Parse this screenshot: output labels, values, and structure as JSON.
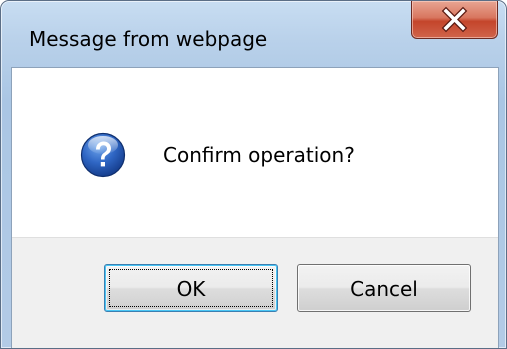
{
  "dialog": {
    "title": "Message from webpage",
    "message": "Confirm operation?",
    "icon": "question-icon",
    "buttons": {
      "ok_label": "OK",
      "cancel_label": "Cancel"
    },
    "colors": {
      "frame": "#b9d1ea",
      "close_button": "#c4452b",
      "button_face": "#ebebeb",
      "button_area": "#f0f0f0",
      "question_icon": "#1a4fa8"
    }
  }
}
